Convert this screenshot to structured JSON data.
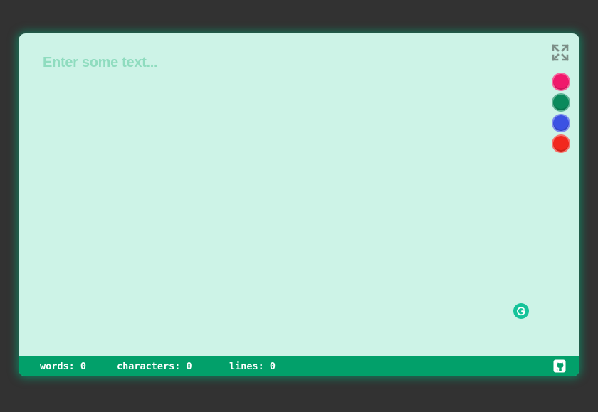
{
  "editor": {
    "placeholder": "Enter some text...",
    "value": ""
  },
  "toolbar": {
    "expand_icon": "expand-icon",
    "swatches": [
      {
        "name": "pink",
        "color": "#f0186c"
      },
      {
        "name": "green",
        "color": "#0a8a5c"
      },
      {
        "name": "blue",
        "color": "#3c52e3"
      },
      {
        "name": "red",
        "color": "#f2281e"
      }
    ]
  },
  "grammarly": {
    "icon": "grammarly-icon",
    "color": "#15c39a"
  },
  "status": {
    "words_label": "words:",
    "words_count": "0",
    "characters_label": "characters:",
    "characters_count": "0",
    "lines_label": "lines:",
    "lines_count": "0",
    "github_icon": "github-icon"
  },
  "colors": {
    "background": "#323232",
    "editor_bg": "#cdf3e7",
    "status_bar": "#02a06a",
    "placeholder": "#8fdcbf"
  }
}
